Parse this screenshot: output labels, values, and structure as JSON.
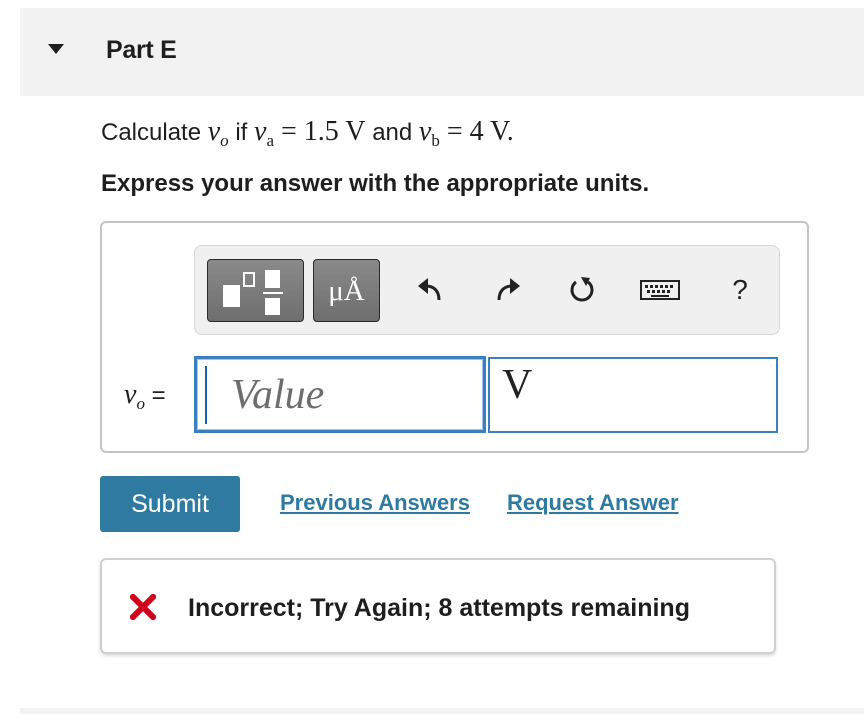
{
  "part": {
    "title": "Part E"
  },
  "question": {
    "prefix": "Calculate",
    "target_var": "v",
    "target_sub": "o",
    "if_word": "if",
    "va_var": "v",
    "va_sub": "a",
    "va_value": "= 1.5 V",
    "and_word": "and",
    "vb_var": "v",
    "vb_sub": "b",
    "vb_value": "= 4 V.",
    "instruction": "Express your answer with the appropriate units."
  },
  "toolbar": {
    "units_label": "μÅ",
    "help_label": "?",
    "icons": [
      "templates-icon",
      "units-icon",
      "undo-icon",
      "redo-icon",
      "reset-icon",
      "keyboard-icon",
      "help-icon"
    ]
  },
  "answer": {
    "var": "v",
    "sub": "o",
    "equals": "=",
    "value_placeholder": "Value",
    "value": "",
    "unit_value": "V"
  },
  "actions": {
    "submit_label": "Submit",
    "previous_answers_label": "Previous Answers",
    "request_answer_label": "Request Answer"
  },
  "feedback": {
    "message": "Incorrect; Try Again; 8 attempts remaining"
  },
  "colors": {
    "accent": "#2e7aa1",
    "input_border": "#3a7fbf",
    "error_red": "#d0021b",
    "header_bg": "#f2f2f2"
  }
}
